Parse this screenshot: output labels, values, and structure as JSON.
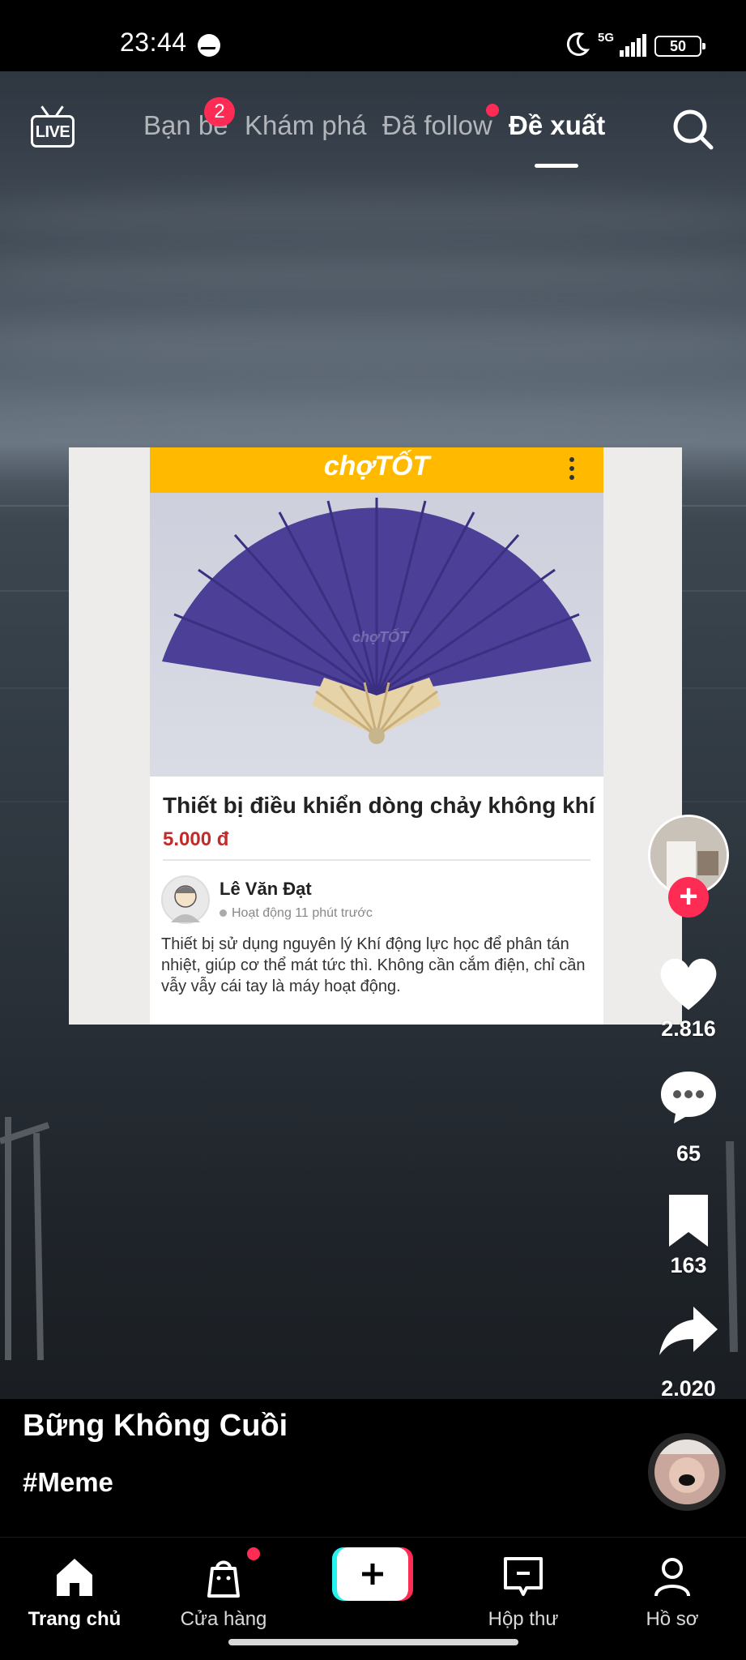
{
  "status_bar": {
    "time": "23:44",
    "network": "5G",
    "battery": "50",
    "icons": [
      "messenger-icon",
      "moon-icon",
      "signal-icon",
      "battery-icon"
    ]
  },
  "top_nav": {
    "live_label": "LIVE",
    "tabs": [
      {
        "label": "Bạn bè",
        "badge": "2"
      },
      {
        "label": "Khám phá"
      },
      {
        "label": "Đã follow",
        "dot": true
      },
      {
        "label": "Đề xuất",
        "active": true
      }
    ],
    "search_icon": "search-icon"
  },
  "post_card": {
    "brand": "chợTỐT",
    "watermark": "chợTỐT",
    "title": "Thiết bị điều khiển dòng chảy không khí",
    "price": "5.000 đ",
    "seller_name": "Lê Văn Đạt",
    "seller_status": "Hoạt động 11 phút trước",
    "description": "Thiết bị sử dụng nguyên lý Khí động lực học để phân tán nhiệt, giúp cơ thể mát tức thì. Không cần cắm điện, chỉ cần vẫy vẫy cái tay là máy hoạt động."
  },
  "actions": {
    "likes": "2.816",
    "comments": "65",
    "saves": "163",
    "shares": "2.020"
  },
  "video_info": {
    "author": "Bững Không Cuồi",
    "hashtag": "#Meme"
  },
  "bottom_nav": {
    "items": [
      {
        "label": "Trang chủ",
        "icon": "home-icon",
        "active": true
      },
      {
        "label": "Cửa hàng",
        "icon": "shop-icon",
        "dot": true
      },
      {
        "label": "",
        "icon": "create-icon"
      },
      {
        "label": "Hộp thư",
        "icon": "inbox-icon"
      },
      {
        "label": "Hồ sơ",
        "icon": "profile-icon"
      }
    ]
  },
  "colors": {
    "accent": "#fe2c55",
    "chotot_yellow": "#ffba00",
    "price_red": "#c02c2c"
  }
}
